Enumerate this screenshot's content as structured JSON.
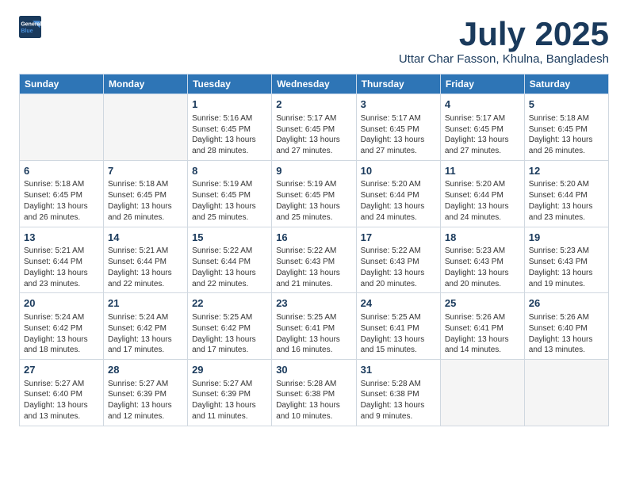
{
  "logo": {
    "line1": "General",
    "line2": "Blue"
  },
  "header": {
    "month": "July 2025",
    "location": "Uttar Char Fasson, Khulna, Bangladesh"
  },
  "days_of_week": [
    "Sunday",
    "Monday",
    "Tuesday",
    "Wednesday",
    "Thursday",
    "Friday",
    "Saturday"
  ],
  "weeks": [
    [
      {
        "day": "",
        "info": ""
      },
      {
        "day": "",
        "info": ""
      },
      {
        "day": "1",
        "info": "Sunrise: 5:16 AM\nSunset: 6:45 PM\nDaylight: 13 hours and 28 minutes."
      },
      {
        "day": "2",
        "info": "Sunrise: 5:17 AM\nSunset: 6:45 PM\nDaylight: 13 hours and 27 minutes."
      },
      {
        "day": "3",
        "info": "Sunrise: 5:17 AM\nSunset: 6:45 PM\nDaylight: 13 hours and 27 minutes."
      },
      {
        "day": "4",
        "info": "Sunrise: 5:17 AM\nSunset: 6:45 PM\nDaylight: 13 hours and 27 minutes."
      },
      {
        "day": "5",
        "info": "Sunrise: 5:18 AM\nSunset: 6:45 PM\nDaylight: 13 hours and 26 minutes."
      }
    ],
    [
      {
        "day": "6",
        "info": "Sunrise: 5:18 AM\nSunset: 6:45 PM\nDaylight: 13 hours and 26 minutes."
      },
      {
        "day": "7",
        "info": "Sunrise: 5:18 AM\nSunset: 6:45 PM\nDaylight: 13 hours and 26 minutes."
      },
      {
        "day": "8",
        "info": "Sunrise: 5:19 AM\nSunset: 6:45 PM\nDaylight: 13 hours and 25 minutes."
      },
      {
        "day": "9",
        "info": "Sunrise: 5:19 AM\nSunset: 6:45 PM\nDaylight: 13 hours and 25 minutes."
      },
      {
        "day": "10",
        "info": "Sunrise: 5:20 AM\nSunset: 6:44 PM\nDaylight: 13 hours and 24 minutes."
      },
      {
        "day": "11",
        "info": "Sunrise: 5:20 AM\nSunset: 6:44 PM\nDaylight: 13 hours and 24 minutes."
      },
      {
        "day": "12",
        "info": "Sunrise: 5:20 AM\nSunset: 6:44 PM\nDaylight: 13 hours and 23 minutes."
      }
    ],
    [
      {
        "day": "13",
        "info": "Sunrise: 5:21 AM\nSunset: 6:44 PM\nDaylight: 13 hours and 23 minutes."
      },
      {
        "day": "14",
        "info": "Sunrise: 5:21 AM\nSunset: 6:44 PM\nDaylight: 13 hours and 22 minutes."
      },
      {
        "day": "15",
        "info": "Sunrise: 5:22 AM\nSunset: 6:44 PM\nDaylight: 13 hours and 22 minutes."
      },
      {
        "day": "16",
        "info": "Sunrise: 5:22 AM\nSunset: 6:43 PM\nDaylight: 13 hours and 21 minutes."
      },
      {
        "day": "17",
        "info": "Sunrise: 5:22 AM\nSunset: 6:43 PM\nDaylight: 13 hours and 20 minutes."
      },
      {
        "day": "18",
        "info": "Sunrise: 5:23 AM\nSunset: 6:43 PM\nDaylight: 13 hours and 20 minutes."
      },
      {
        "day": "19",
        "info": "Sunrise: 5:23 AM\nSunset: 6:43 PM\nDaylight: 13 hours and 19 minutes."
      }
    ],
    [
      {
        "day": "20",
        "info": "Sunrise: 5:24 AM\nSunset: 6:42 PM\nDaylight: 13 hours and 18 minutes."
      },
      {
        "day": "21",
        "info": "Sunrise: 5:24 AM\nSunset: 6:42 PM\nDaylight: 13 hours and 17 minutes."
      },
      {
        "day": "22",
        "info": "Sunrise: 5:25 AM\nSunset: 6:42 PM\nDaylight: 13 hours and 17 minutes."
      },
      {
        "day": "23",
        "info": "Sunrise: 5:25 AM\nSunset: 6:41 PM\nDaylight: 13 hours and 16 minutes."
      },
      {
        "day": "24",
        "info": "Sunrise: 5:25 AM\nSunset: 6:41 PM\nDaylight: 13 hours and 15 minutes."
      },
      {
        "day": "25",
        "info": "Sunrise: 5:26 AM\nSunset: 6:41 PM\nDaylight: 13 hours and 14 minutes."
      },
      {
        "day": "26",
        "info": "Sunrise: 5:26 AM\nSunset: 6:40 PM\nDaylight: 13 hours and 13 minutes."
      }
    ],
    [
      {
        "day": "27",
        "info": "Sunrise: 5:27 AM\nSunset: 6:40 PM\nDaylight: 13 hours and 13 minutes."
      },
      {
        "day": "28",
        "info": "Sunrise: 5:27 AM\nSunset: 6:39 PM\nDaylight: 13 hours and 12 minutes."
      },
      {
        "day": "29",
        "info": "Sunrise: 5:27 AM\nSunset: 6:39 PM\nDaylight: 13 hours and 11 minutes."
      },
      {
        "day": "30",
        "info": "Sunrise: 5:28 AM\nSunset: 6:38 PM\nDaylight: 13 hours and 10 minutes."
      },
      {
        "day": "31",
        "info": "Sunrise: 5:28 AM\nSunset: 6:38 PM\nDaylight: 13 hours and 9 minutes."
      },
      {
        "day": "",
        "info": ""
      },
      {
        "day": "",
        "info": ""
      }
    ]
  ]
}
